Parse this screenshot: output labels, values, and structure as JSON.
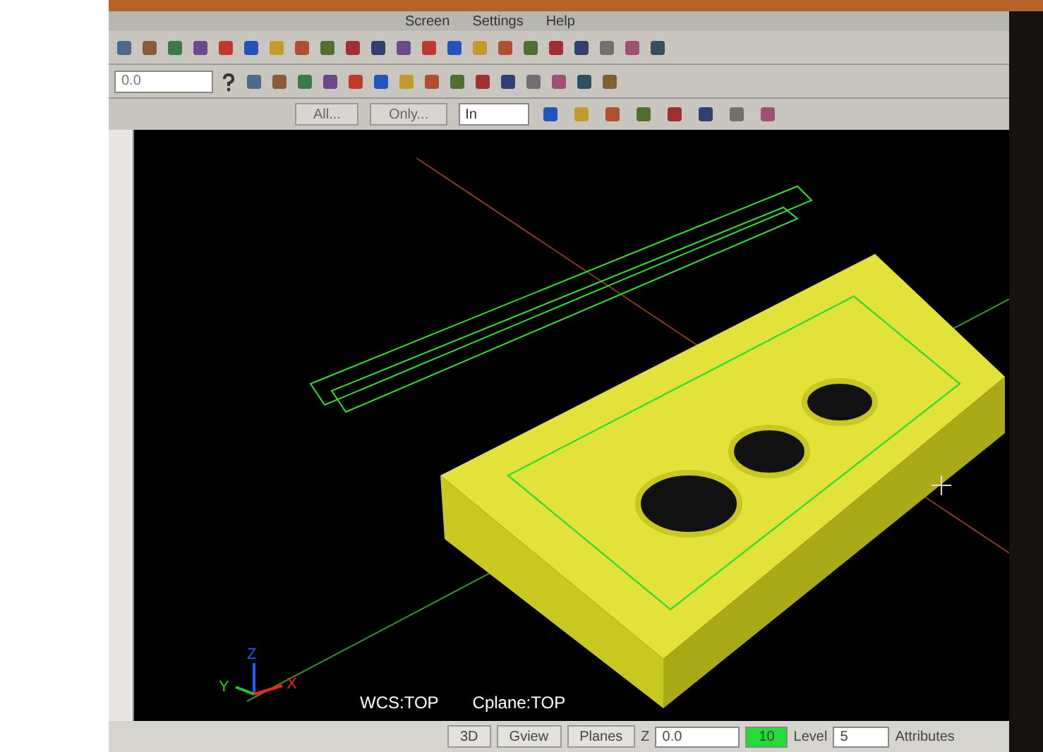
{
  "menu": [
    "Screen",
    "Settings",
    "Help"
  ],
  "toolbar": {
    "number_field": "0.0",
    "buttons": [
      "All...",
      "Only..."
    ],
    "units_field": "In"
  },
  "viewport": {
    "wcs": "WCS:TOP",
    "cplane": "Cplane:TOP",
    "axes": [
      "X",
      "Y",
      "Z"
    ]
  },
  "status_bar": {
    "buttons": [
      "3D",
      "Gview",
      "Planes"
    ],
    "z_label": "Z",
    "z_field": "0.0",
    "color_field": "10",
    "level_label": "Level",
    "level_field": "5",
    "attributes_label": "Attributes"
  }
}
